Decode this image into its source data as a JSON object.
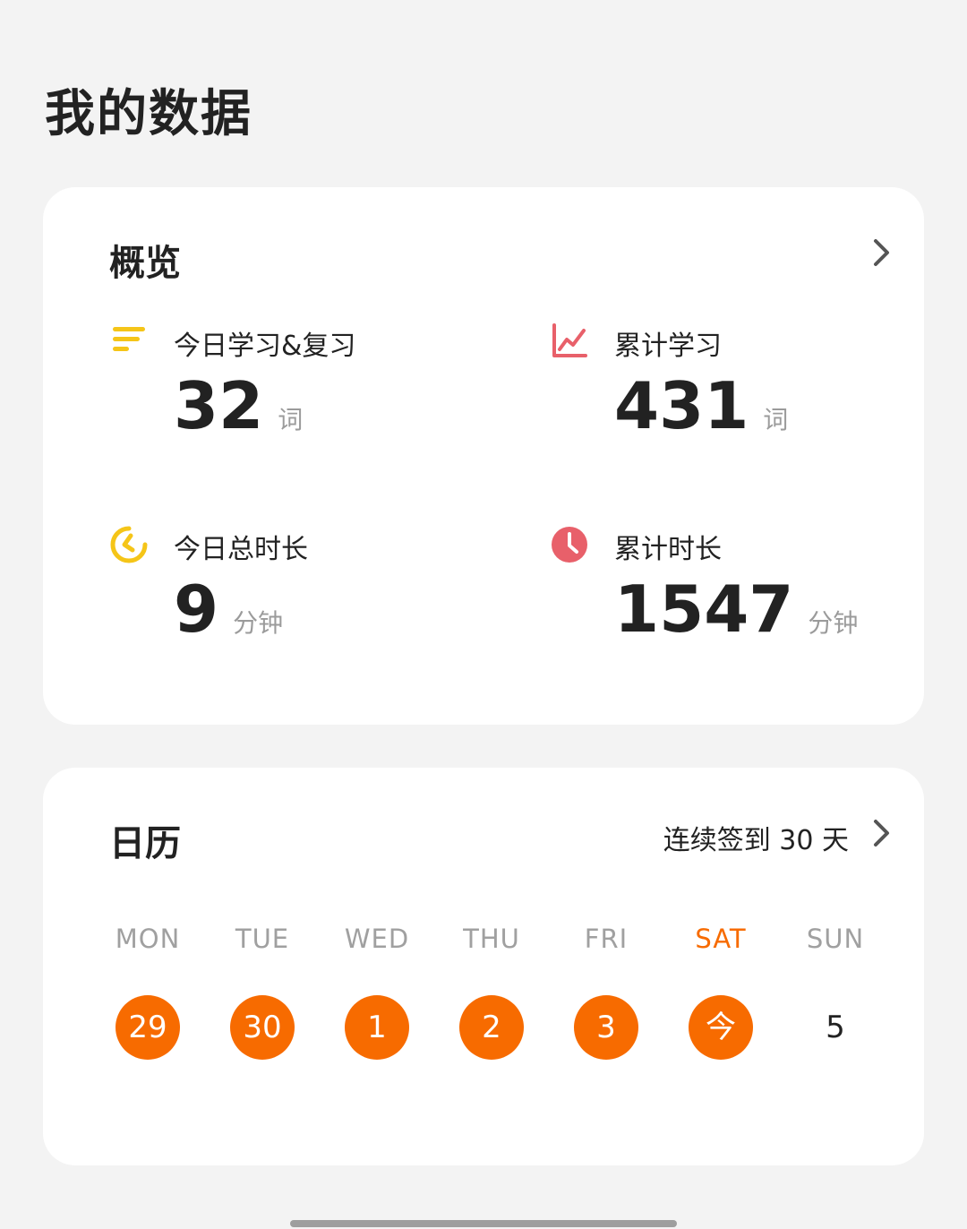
{
  "page": {
    "title": "我的数据"
  },
  "colors": {
    "accent": "#f76b00",
    "yellow": "#f5c518",
    "red": "#e8606a"
  },
  "overview": {
    "title": "概览",
    "stats": [
      {
        "label": "今日学习&复习",
        "value": "32",
        "unit": "词",
        "icon": "list-lines-icon"
      },
      {
        "label": "累计学习",
        "value": "431",
        "unit": "词",
        "icon": "line-chart-icon"
      },
      {
        "label": "今日总时长",
        "value": "9",
        "unit": "分钟",
        "icon": "timer-icon"
      },
      {
        "label": "累计时长",
        "value": "1547",
        "unit": "分钟",
        "icon": "clock-icon"
      }
    ]
  },
  "calendar": {
    "title": "日历",
    "streak": "连续签到 30 天",
    "days": [
      {
        "dow": "MON",
        "date": "29",
        "checked": true
      },
      {
        "dow": "TUE",
        "date": "30",
        "checked": true
      },
      {
        "dow": "WED",
        "date": "1",
        "checked": true
      },
      {
        "dow": "THU",
        "date": "2",
        "checked": true
      },
      {
        "dow": "FRI",
        "date": "3",
        "checked": true
      },
      {
        "dow": "SAT",
        "date": "今",
        "checked": true,
        "today": true
      },
      {
        "dow": "SUN",
        "date": "5",
        "checked": false
      }
    ]
  }
}
